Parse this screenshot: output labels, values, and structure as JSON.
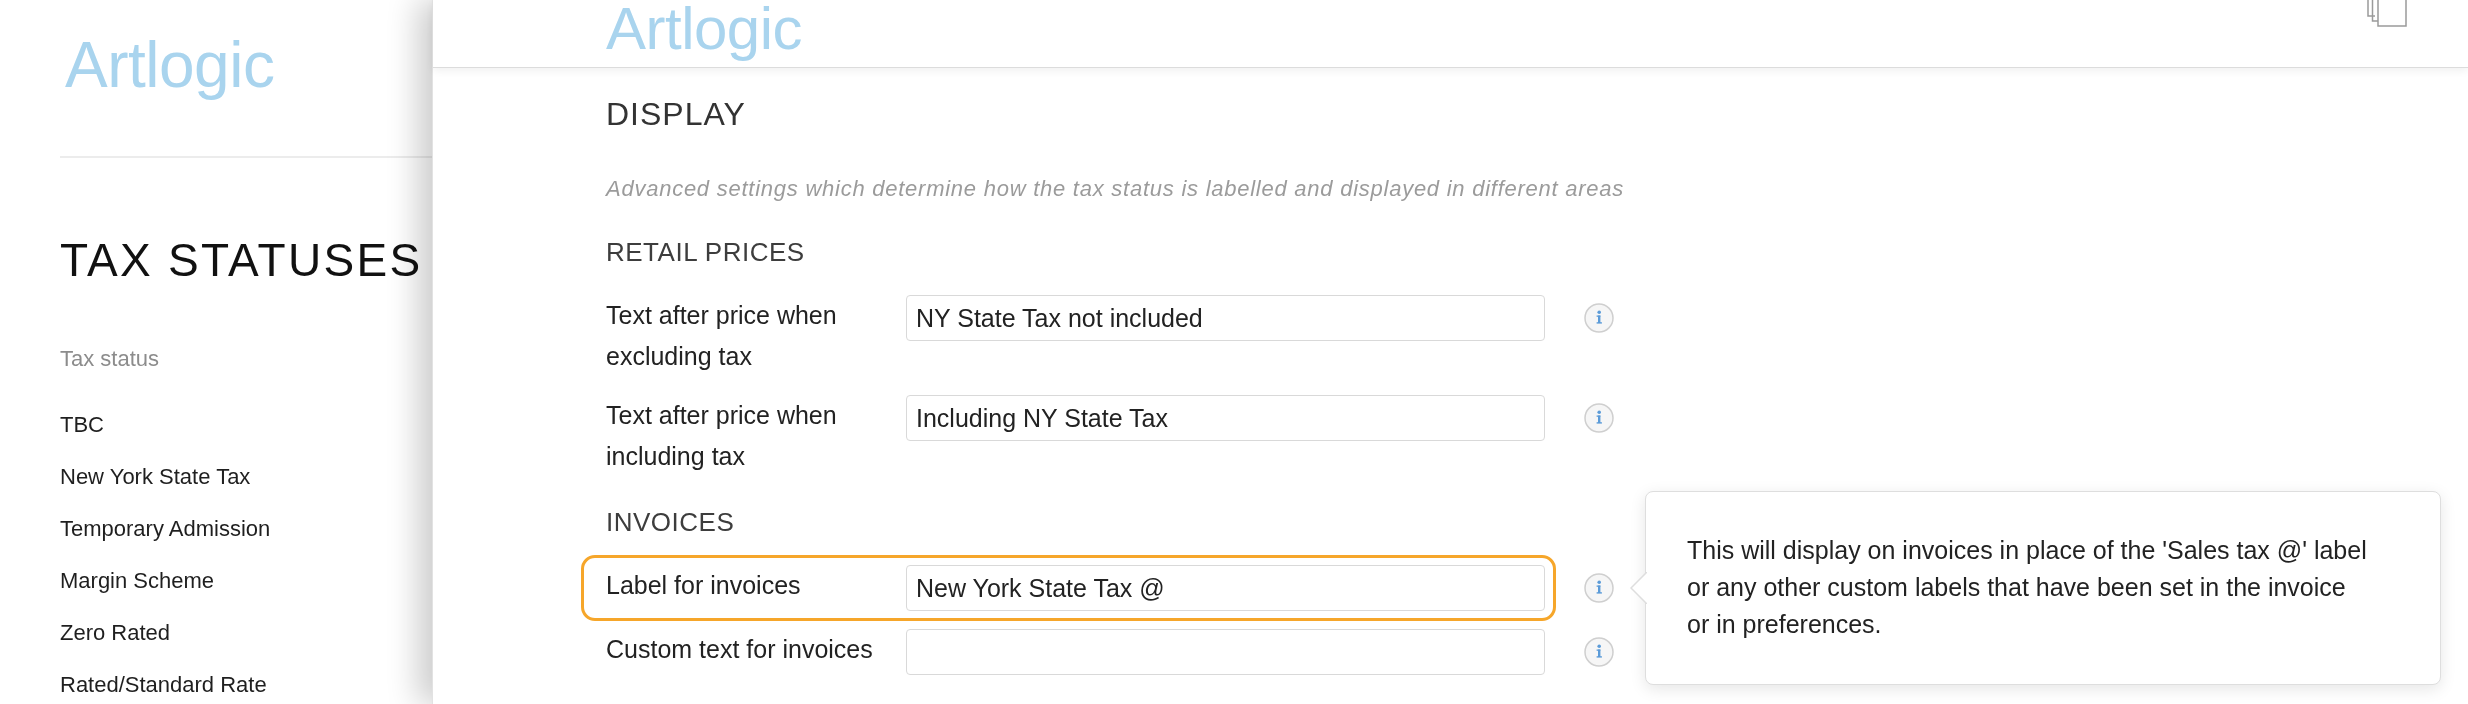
{
  "sidebar": {
    "logo": "Artlogic",
    "title": "TAX STATUSES",
    "list_header": "Tax status",
    "items": [
      "TBC",
      "New York State Tax",
      "Temporary Admission",
      "Margin Scheme",
      "Zero Rated",
      "Rated/Standard Rate"
    ]
  },
  "panel": {
    "logo": "Artlogic",
    "heading": "DISPLAY",
    "description": "Advanced settings which determine how the tax status is labelled and displayed in different areas",
    "groups": [
      {
        "title": "RETAIL PRICES",
        "fields": [
          {
            "label": "Text after price when excluding tax",
            "value": "NY State Tax not included",
            "highlighted": false
          },
          {
            "label": "Text after price when including tax",
            "value": "Including NY State Tax",
            "highlighted": false
          }
        ]
      },
      {
        "title": "INVOICES",
        "fields": [
          {
            "label": "Label for invoices",
            "value": "New York State Tax @",
            "highlighted": true,
            "tooltip": "This will display on invoices in place of the 'Sales tax @' label or any other custom labels that have been set in the invoice or in preferences."
          },
          {
            "label": "Custom text for invoices",
            "highlighted": false
          }
        ]
      }
    ]
  }
}
